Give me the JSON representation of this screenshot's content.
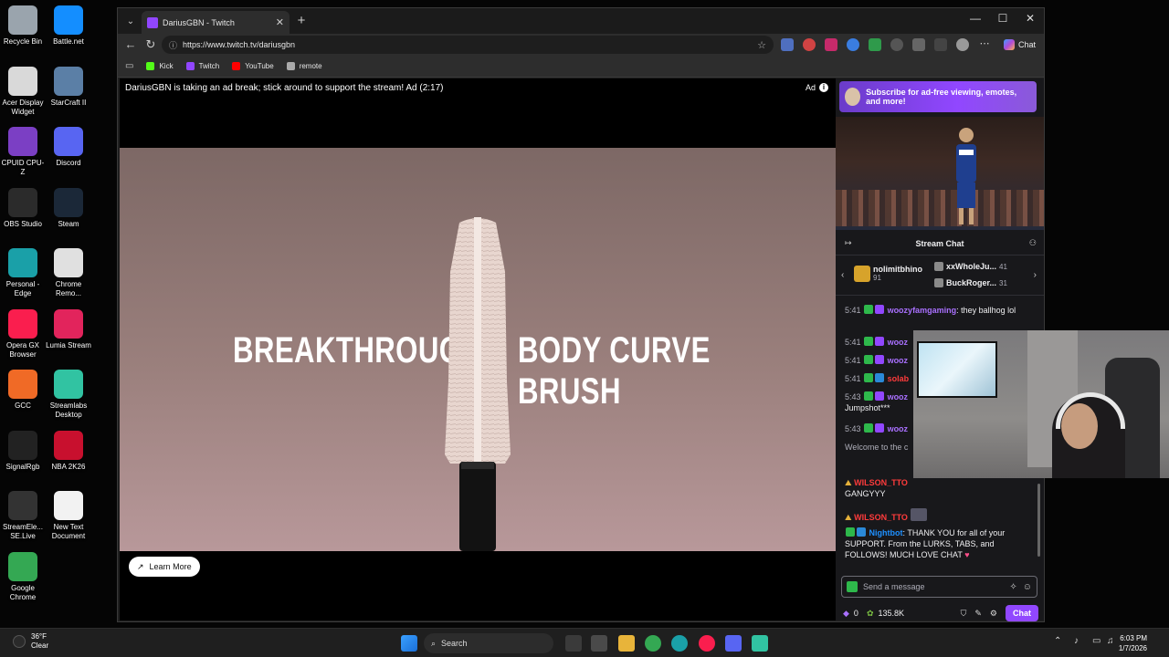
{
  "desktop": {
    "icons": [
      {
        "label": "Recycle Bin",
        "icon": "recycle-bin-icon",
        "color": "#9aa4ad"
      },
      {
        "label": "Battle.net",
        "icon": "battlenet-icon",
        "color": "#148eff"
      },
      {
        "label": "Acer Display Widget",
        "icon": "acer-display-widget-icon",
        "color": "#d9d9d9"
      },
      {
        "label": "StarCraft II",
        "icon": "starcraft-icon",
        "color": "#5b7fa6"
      },
      {
        "label": "CPUID CPU-Z",
        "icon": "cpuz-icon",
        "color": "#7b3fc4"
      },
      {
        "label": "Discord",
        "icon": "discord-icon",
        "color": "#5865f2"
      },
      {
        "label": "OBS Studio",
        "icon": "obs-icon",
        "color": "#2b2b2b"
      },
      {
        "label": "Steam",
        "icon": "steam-icon",
        "color": "#1b2838"
      },
      {
        "label": "Personal - Edge",
        "icon": "edge-icon",
        "color": "#1aa0a8"
      },
      {
        "label": "Chrome Remo...",
        "icon": "chrome-remote-icon",
        "color": "#e0e0e0"
      },
      {
        "label": "Opera GX Browser",
        "icon": "operagx-icon",
        "color": "#fa1e4e"
      },
      {
        "label": "Lumia Stream",
        "icon": "lumia-icon",
        "color": "#e2245c"
      },
      {
        "label": "GCC",
        "icon": "gcc-icon",
        "color": "#f06a26"
      },
      {
        "label": "Streamlabs Desktop",
        "icon": "streamlabs-icon",
        "color": "#31c3a2"
      },
      {
        "label": "SignalRgb",
        "icon": "signalrgb-icon",
        "color": "#222"
      },
      {
        "label": "NBA 2K26",
        "icon": "nba2k-icon",
        "color": "#c8102e"
      },
      {
        "label": "StreamEle... SE.Live",
        "icon": "streamelements-icon",
        "color": "#333"
      },
      {
        "label": "New Text Document",
        "icon": "text-document-icon",
        "color": "#f2f2f2"
      },
      {
        "label": "Google Chrome",
        "icon": "chrome-icon",
        "color": "#34a853"
      }
    ]
  },
  "browser": {
    "tab_title": "DariusGBN - Twitch",
    "url": "https://www.twitch.tv/dariusgbn",
    "chat_button": "Chat",
    "bookmarks": [
      {
        "label": "Kick",
        "color": "#53fc18"
      },
      {
        "label": "Twitch",
        "color": "#9146ff"
      },
      {
        "label": "YouTube",
        "color": "#ff0000"
      },
      {
        "label": "remote",
        "color": "#aaaaaa"
      }
    ]
  },
  "video": {
    "ad_message": "DariusGBN is taking an ad break; stick around to support the stream! Ad (2:17)",
    "ad_label": "Ad",
    "headline_left": "BREAKTHROUGH",
    "headline_right": "BODY CURVE BRUSH",
    "learn_more": "Learn More"
  },
  "sidebar": {
    "sub_banner": "Subscribe for ad-free viewing, emotes, and more!",
    "chat_title": "Stream Chat",
    "leaderboard": [
      {
        "name": "nolimitbhino",
        "points": "91"
      },
      {
        "name": "xxWholeJu...",
        "points": "41"
      },
      {
        "name": "BuckRoger...",
        "points": "31"
      }
    ],
    "messages": [
      {
        "time": "5:41",
        "user": "woozyfamgaming",
        "text": ": they ballhog lol"
      },
      {
        "time": "5:41",
        "user": "wooz",
        "text": ""
      },
      {
        "time": "5:41",
        "user": "wooz",
        "text": ""
      },
      {
        "time": "5:41",
        "user": "solab",
        "text": ""
      },
      {
        "time": "5:43",
        "user": "wooz",
        "text": "",
        "extra": "Jumpshot***"
      },
      {
        "time": "5:43",
        "user": "wooz",
        "text": ""
      }
    ],
    "welcome": "Welcome to the c",
    "gang_user": "WILSON_TTO",
    "gang_text": "GANGYYY",
    "gang_user2": "WILSON_TTO",
    "bot_user": "Nightbot",
    "bot_text": ": THANK YOU for all of your SUPPORT. From the LURKS, TABS, and FOLLOWS! MUCH LOVE CHAT",
    "send_placeholder": "Send a message",
    "points_count": "0",
    "channel_points": "135.8K",
    "chat_send": "Chat"
  },
  "taskbar": {
    "temp": "36°F",
    "condition": "Clear",
    "search": "Search",
    "time": "6:03 PM",
    "date": "1/7/2026"
  }
}
